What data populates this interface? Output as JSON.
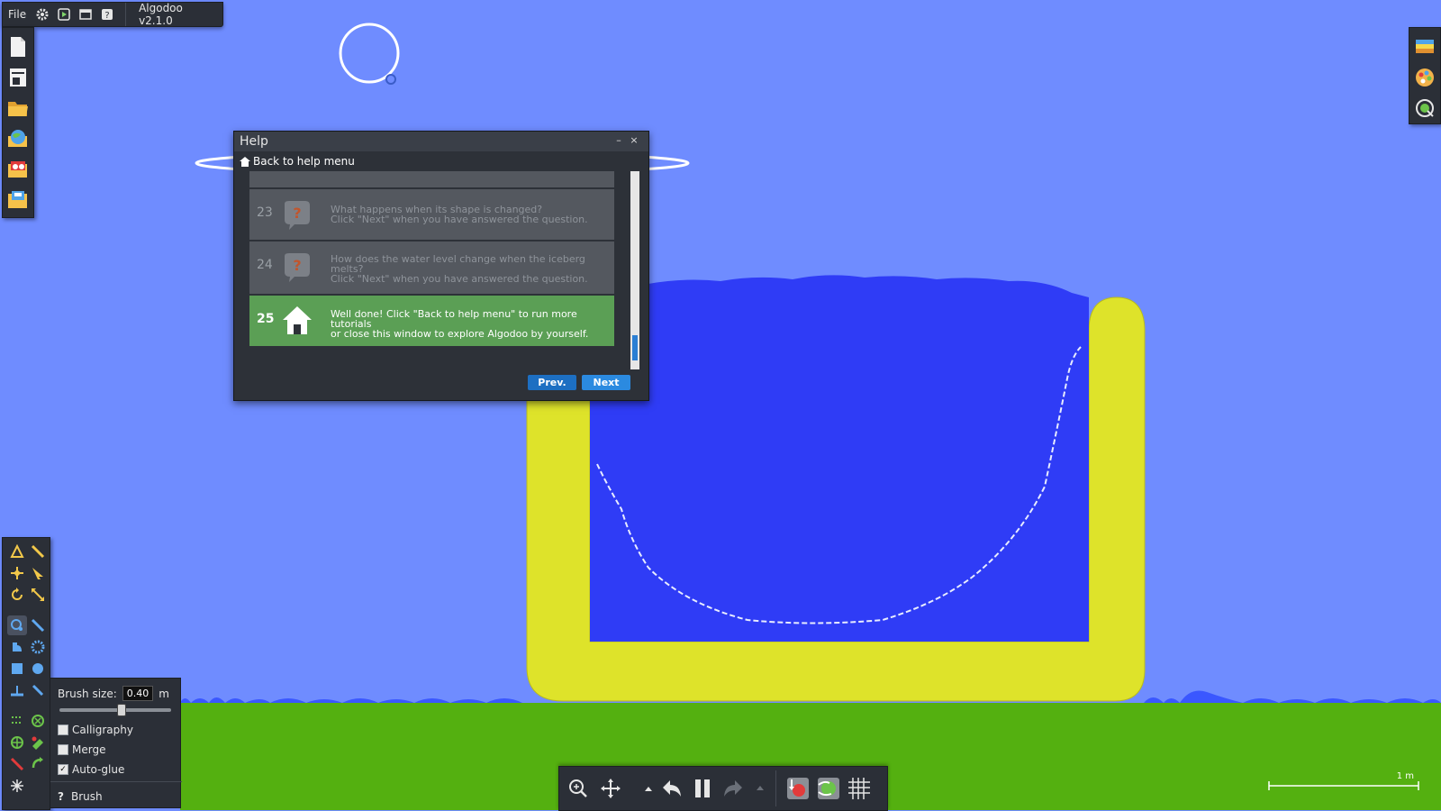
{
  "menu": {
    "file_label": "File",
    "app_name": "Algodoo v2.1.0",
    "icons": [
      "gear-icon",
      "play-scene-icon",
      "window-icon",
      "help-icon"
    ]
  },
  "left_toolbar": {
    "icons": [
      "new-scene-icon",
      "printer-icon",
      "open-folder-icon",
      "globe-icon",
      "scene-library-icon",
      "save-folder-icon"
    ]
  },
  "right_toolbar": {
    "icons": [
      "background-icon",
      "palette-icon",
      "zoom-fit-icon"
    ]
  },
  "tools": {
    "icons": [
      "sketch-tool-icon",
      "cut-tool-icon",
      "move-tool-icon",
      "drag-tool-icon",
      "rotate-tool-icon",
      "scale-tool-icon",
      "brush-tool-icon",
      "knife-tool-icon",
      "fixate-tool-icon",
      "gear-tool-icon",
      "box-tool-icon",
      "circle-tool-icon",
      "plane-tool-icon",
      "spring-tool-icon",
      "chain-tool-icon",
      "hinge-tool-icon",
      "axle-tool-icon",
      "thruster-tool-icon",
      "laser-tool-icon",
      "tracer-tool-icon",
      "fluid-tool-icon"
    ]
  },
  "brush_options": {
    "size_label": "Brush size:",
    "size_value": "0.40",
    "size_unit": "m",
    "slider_level": 0.55,
    "calligraphy_label": "Calligraphy",
    "calligraphy_checked": false,
    "merge_label": "Merge",
    "merge_checked": false,
    "autoglue_label": "Auto-glue",
    "autoglue_checked": true,
    "tool_label": "Brush",
    "help_glyph": "?"
  },
  "help_window": {
    "title": "Help",
    "minimize_glyph": "–",
    "close_glyph": "×",
    "back_label": "Back to help menu",
    "steps": [
      {
        "num": "23",
        "text_line1": "What happens when its shape is changed?",
        "text_line2": "Click \"Next\" when you have answered the question.",
        "text_line3": ""
      },
      {
        "num": "24",
        "text_line1": "How does the water level change when the iceberg",
        "text_line2": "melts?",
        "text_line3": "Click \"Next\" when you have answered the question."
      },
      {
        "num": "25",
        "text_line1": "Well done! Click \"Back to help menu\" to run more tutorials",
        "text_line2": "or close this window to explore Algodoo by yourself.",
        "text_line3": ""
      }
    ],
    "prev_label": "Prev.",
    "next_label": "Next"
  },
  "bottom_toolbar": {
    "icons": [
      "zoom-icon",
      "pan-icon",
      "up-arrow-icon",
      "undo-icon",
      "pause-icon",
      "redo-icon",
      "down-arrow-icon",
      "gravity-icon",
      "air-icon",
      "grid-icon"
    ]
  },
  "scale": {
    "label": "1 m"
  },
  "colors": {
    "sky": "#6f8cff",
    "ground": "#54b010",
    "water": "#2f3cf6",
    "container": "#dee32a",
    "panel": "#2b2f37",
    "accent": "#2b8ae0"
  }
}
